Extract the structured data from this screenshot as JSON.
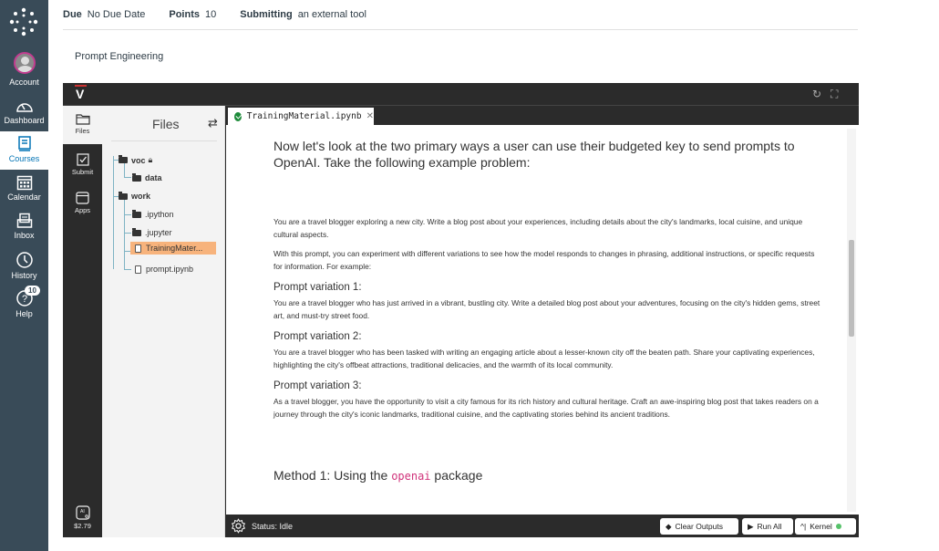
{
  "global_nav": {
    "items": [
      {
        "label": "Account",
        "icon": "avatar"
      },
      {
        "label": "Dashboard",
        "icon": "dashboard-icon"
      },
      {
        "label": "Courses",
        "icon": "courses-icon",
        "active": true
      },
      {
        "label": "Calendar",
        "icon": "calendar-icon"
      },
      {
        "label": "Inbox",
        "icon": "inbox-icon"
      },
      {
        "label": "History",
        "icon": "history-icon"
      },
      {
        "label": "Help",
        "icon": "help-icon",
        "badge": "10"
      }
    ]
  },
  "assignment_meta": {
    "due_label": "Due",
    "due_value": "No Due Date",
    "points_label": "Points",
    "points_value": "10",
    "submitting_label": "Submitting",
    "submitting_value": "an external tool"
  },
  "page_title": "Prompt Engineering",
  "tool": {
    "logo": "V",
    "left_bar": [
      {
        "label": "Files",
        "icon": "folder-icon",
        "active": true
      },
      {
        "label": "Submit",
        "icon": "checkbox-icon"
      },
      {
        "label": "Apps",
        "icon": "apps-icon"
      }
    ],
    "budget": {
      "label": "AI",
      "value": "$2.79"
    },
    "files_panel": {
      "title": "Files",
      "tree": [
        {
          "name": "voc",
          "type": "folder-open",
          "locked": true,
          "depth": 0
        },
        {
          "name": "data",
          "type": "folder",
          "depth": 1
        },
        {
          "name": "work",
          "type": "folder-open",
          "depth": 0
        },
        {
          "name": ".ipython",
          "type": "folder",
          "depth": 1
        },
        {
          "name": ".jupyter",
          "type": "folder",
          "depth": 1
        },
        {
          "name": "TrainingMater...",
          "type": "file",
          "depth": 1,
          "selected": true
        },
        {
          "name": "prompt.ipynb",
          "type": "file",
          "depth": 1
        }
      ]
    },
    "tab": {
      "label": "TrainingMaterial.ipynb"
    },
    "notebook": {
      "intro": "Now let's look at the two primary ways a user can use their budgeted key to send prompts to OpenAI. Take the following example problem:",
      "example": "You are a travel blogger exploring a new city. Write a blog post about your experiences, including details about the city's landmarks, local cuisine, and unique cultural aspects.",
      "explain": "With this prompt, you can experiment with different variations to see how the model responds to changes in phrasing, additional instructions, or specific requests for information. For example:",
      "variations": [
        {
          "title": "Prompt variation 1:",
          "text": "You are a travel blogger who has just arrived in a vibrant, bustling city. Write a detailed blog post about your adventures, focusing on the city's hidden gems, street art, and must-try street food."
        },
        {
          "title": "Prompt variation 2:",
          "text": "You are a travel blogger who has been tasked with writing an engaging article about a lesser-known city off the beaten path. Share your captivating experiences, highlighting the city's offbeat attractions, traditional delicacies, and the warmth of its local community."
        },
        {
          "title": "Prompt variation 3:",
          "text": "As a travel blogger, you have the opportunity to visit a city famous for its rich history and cultural heritage. Craft an awe-inspiring blog post that takes readers on a journey through the city's iconic landmarks, traditional cuisine, and the captivating stories behind its ancient traditions."
        }
      ],
      "method_prefix": "Method 1: Using the ",
      "method_code": "openai",
      "method_suffix": " package"
    },
    "status_bar": {
      "status": "Status: Idle",
      "clear_outputs": "Clear Outputs",
      "run_all": "Run All",
      "kernel": "Kernel",
      "kernel_color": "#56c26a"
    }
  }
}
